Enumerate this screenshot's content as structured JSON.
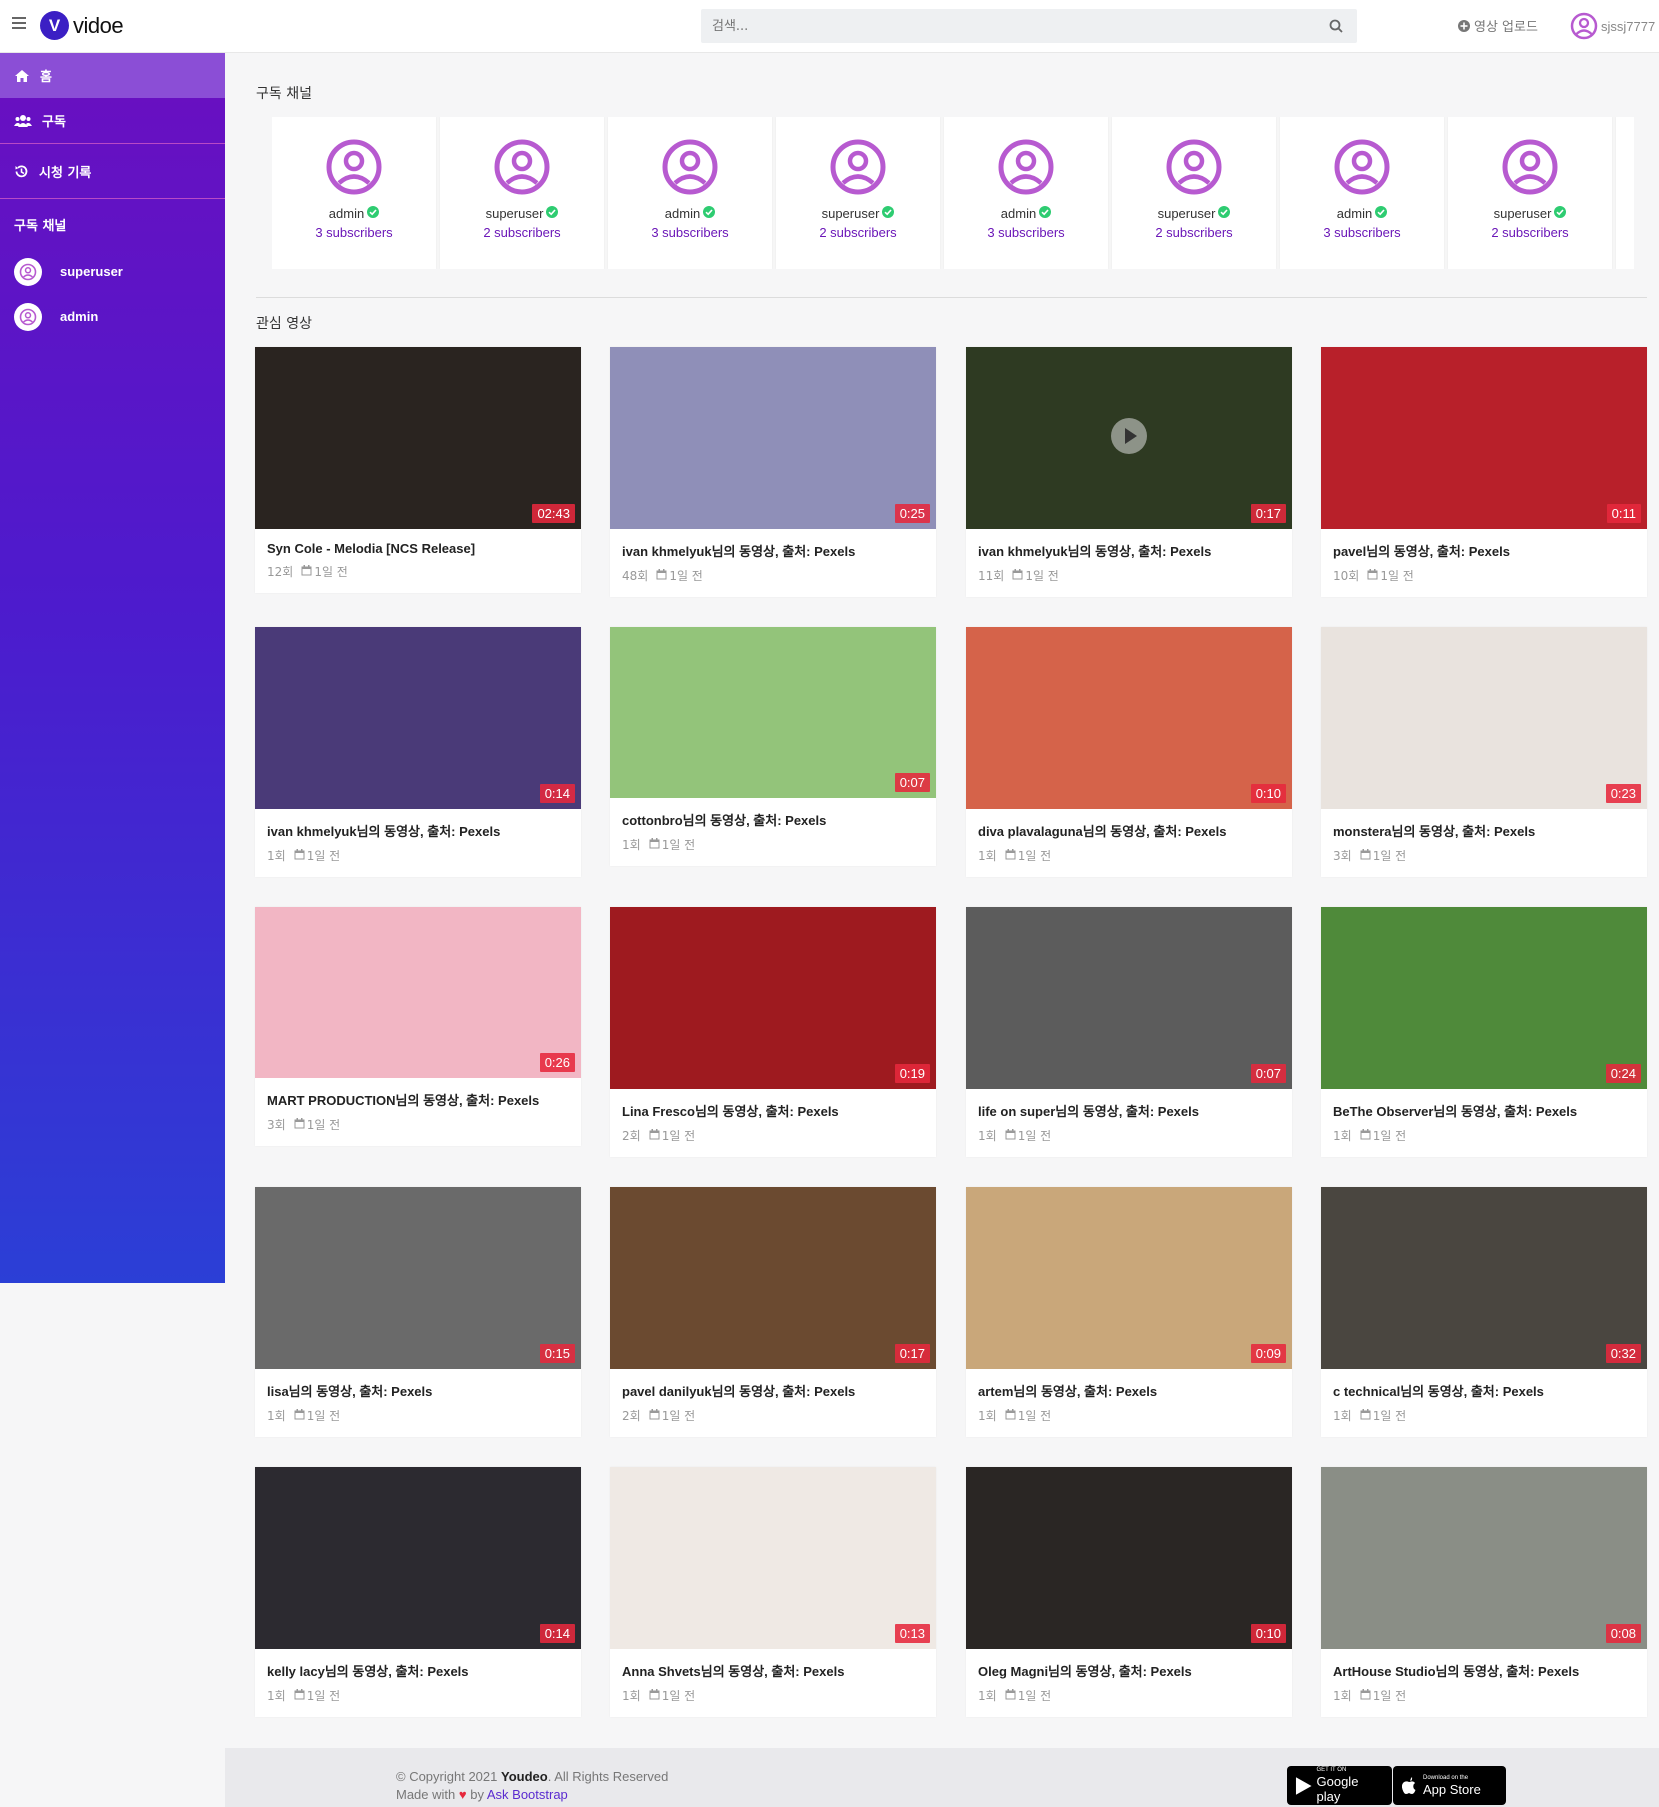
{
  "header": {
    "logo_letter": "V",
    "logo_text": "vidoe",
    "search_placeholder": "검색...",
    "upload_label": "영상 업로드",
    "username": "sjssj7777"
  },
  "sidebar": {
    "items": [
      {
        "label": "홈",
        "icon": "home-icon",
        "active": true
      },
      {
        "label": "구독",
        "icon": "users-icon",
        "active": false
      },
      {
        "label": "시청 기록",
        "icon": "history-icon",
        "active": false
      }
    ],
    "channels_heading": "구독 채널",
    "channels": [
      {
        "label": "superuser"
      },
      {
        "label": "admin"
      }
    ]
  },
  "main": {
    "subscribed_title": "구독 채널",
    "featured_title": "관심 영상",
    "channels": [
      {
        "name": "admin",
        "subs": "3 subscribers"
      },
      {
        "name": "superuser",
        "subs": "2 subscribers"
      },
      {
        "name": "admin",
        "subs": "3 subscribers"
      },
      {
        "name": "superuser",
        "subs": "2 subscribers"
      },
      {
        "name": "admin",
        "subs": "3 subscribers"
      },
      {
        "name": "superuser",
        "subs": "2 subscribers"
      },
      {
        "name": "admin",
        "subs": "3 subscribers"
      },
      {
        "name": "superuser",
        "subs": "2 subscribers"
      }
    ],
    "videos": [
      {
        "title": "Syn Cole - Melodia [NCS Release]",
        "views": "12회",
        "date": "1일 전",
        "duration": "02:43",
        "thumb_color": "#2a2420"
      },
      {
        "title": "ivan khmelyuk님의 동영상, 출처: Pexels",
        "views": "48회",
        "date": "1일 전",
        "duration": "0:25",
        "thumb_color": "#8f8fb8"
      },
      {
        "title": "ivan khmelyuk님의 동영상, 출처: Pexels",
        "views": "11회",
        "date": "1일 전",
        "duration": "0:17",
        "thumb_color": "#2e3a22"
      },
      {
        "title": "pavel님의 동영상, 출처: Pexels",
        "views": "10회",
        "date": "1일 전",
        "duration": "0:11",
        "thumb_color": "#b8202a"
      },
      {
        "title": "ivan khmelyuk님의 동영상, 출처: Pexels",
        "views": "1회",
        "date": "1일 전",
        "duration": "0:14",
        "thumb_color": "#4a3a78"
      },
      {
        "title": "cottonbro님의 동영상, 출처: Pexels",
        "views": "1회",
        "date": "1일 전",
        "duration": "0:07",
        "thumb_color": "#93c47a"
      },
      {
        "title": "diva plavalaguna님의 동영상, 출처: Pexels",
        "views": "1회",
        "date": "1일 전",
        "duration": "0:10",
        "thumb_color": "#d5634a"
      },
      {
        "title": "monstera님의 동영상, 출처: Pexels",
        "views": "3회",
        "date": "1일 전",
        "duration": "0:23",
        "thumb_color": "#e9e3de"
      },
      {
        "title": "MART PRODUCTION님의 동영상, 출처: Pexels",
        "views": "3회",
        "date": "1일 전",
        "duration": "0:26",
        "thumb_color": "#f2b6c4"
      },
      {
        "title": "Lina Fresco님의 동영상, 출처: Pexels",
        "views": "2회",
        "date": "1일 전",
        "duration": "0:19",
        "thumb_color": "#9e1a1f"
      },
      {
        "title": "life on super님의 동영상, 출처: Pexels",
        "views": "1회",
        "date": "1일 전",
        "duration": "0:07",
        "thumb_color": "#5c5c5c"
      },
      {
        "title": "BeThe Observer님의 동영상, 출처: Pexels",
        "views": "1회",
        "date": "1일 전",
        "duration": "0:24",
        "thumb_color": "#4f8a3a"
      },
      {
        "title": "lisa님의 동영상, 출처: Pexels",
        "views": "1회",
        "date": "1일 전",
        "duration": "0:15",
        "thumb_color": "#6a6a6a"
      },
      {
        "title": "pavel danilyuk님의 동영상, 출처: Pexels",
        "views": "2회",
        "date": "1일 전",
        "duration": "0:17",
        "thumb_color": "#6b4a30"
      },
      {
        "title": "artem님의 동영상, 출처: Pexels",
        "views": "1회",
        "date": "1일 전",
        "duration": "0:09",
        "thumb_color": "#c9a77a"
      },
      {
        "title": "c technical님의 동영상, 출처: Pexels",
        "views": "1회",
        "date": "1일 전",
        "duration": "0:32",
        "thumb_color": "#4a4640"
      },
      {
        "title": "kelly lacy님의 동영상, 출처: Pexels",
        "views": "1회",
        "date": "1일 전",
        "duration": "0:14",
        "thumb_color": "#2c2a30"
      },
      {
        "title": "Anna Shvets님의 동영상, 출처: Pexels",
        "views": "1회",
        "date": "1일 전",
        "duration": "0:13",
        "thumb_color": "#efe9e4"
      },
      {
        "title": "Oleg Magni님의 동영상, 출처: Pexels",
        "views": "1회",
        "date": "1일 전",
        "duration": "0:10",
        "thumb_color": "#2a2624"
      },
      {
        "title": "ArtHouse Studio님의 동영상, 출처: Pexels",
        "views": "1회",
        "date": "1일 전",
        "duration": "0:08",
        "thumb_color": "#8a8e86"
      }
    ]
  },
  "footer": {
    "copyright": "© Copyright 2021",
    "brand": "Youdeo",
    "rights": ". All Rights Reserved",
    "made_with": "Made with",
    "by": "by",
    "link": "Ask Bootstrap",
    "google_small": "GET IT ON",
    "google_big": "Google play",
    "apple_small": "Download on the",
    "apple_big": "App Store"
  },
  "colors": {
    "accent": "#6b17b8",
    "duration_badge": "#e6283c",
    "verified": "#2ecc71",
    "avatar": "#b75ad0"
  }
}
